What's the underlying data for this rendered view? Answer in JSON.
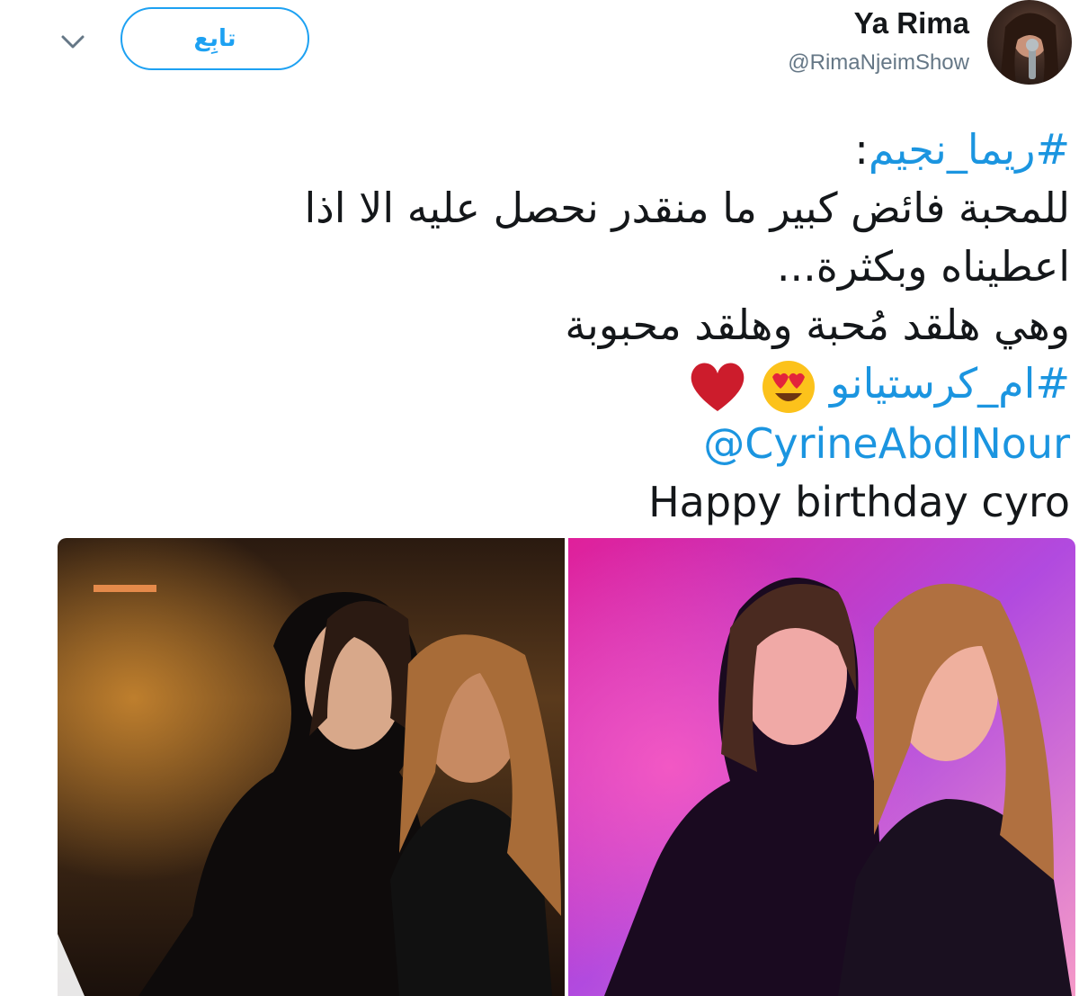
{
  "header": {
    "follow_label": "تابِع",
    "display_name": "Ya Rima",
    "handle": "@RimaNjeimShow",
    "avatar_icon": "profile-avatar"
  },
  "tweet": {
    "hashtag1": "#ريما_نجيم",
    "colon": ":",
    "line2": "للمحبة فائض كبير ما منقدر نحصل عليه الا اذا",
    "line3": "اعطيناه وبكثرة...",
    "line4": "وهي هلقد مُحبة وهلقد محبوبة",
    "hashtag2": "#ام_كرستيانو",
    "mention": "@CyrineAbdlNour",
    "line7": "Happy birthday cyro",
    "emojis": [
      "heart-eyes-emoji",
      "red-heart-emoji"
    ]
  },
  "media": {
    "photos": [
      "photo-left",
      "photo-right"
    ]
  },
  "colors": {
    "accent": "#1da1f2",
    "link": "#1b95e0",
    "text": "#14171a",
    "muted": "#657786"
  }
}
